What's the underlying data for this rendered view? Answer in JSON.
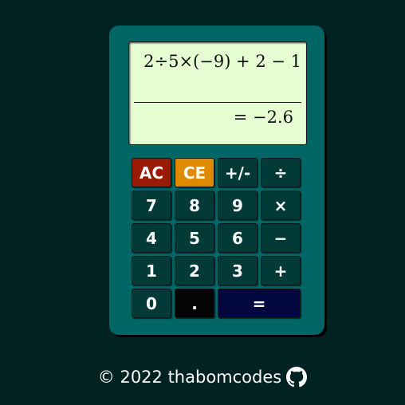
{
  "display": {
    "expression": "2÷5×(−9) + 2 − 1",
    "result": "= −2.6"
  },
  "keys": {
    "ac": "AC",
    "ce": "CE",
    "sign": "+/-",
    "divide": "÷",
    "seven": "7",
    "eight": "8",
    "nine": "9",
    "multiply": "×",
    "four": "4",
    "five": "5",
    "six": "6",
    "subtract": "−",
    "one": "1",
    "two": "2",
    "three": "3",
    "add": "+",
    "zero": "0",
    "dot": ".",
    "equals": "="
  },
  "footer": {
    "text": "© 2022 thabomcodes",
    "icon": "github-icon"
  },
  "colors": {
    "background": "#002222",
    "body": "#006565",
    "display": "#e6ffd2",
    "key": "#013a36",
    "clear": "#9a1b05",
    "clear_entry": "#e08a00",
    "equals": "#020740"
  }
}
